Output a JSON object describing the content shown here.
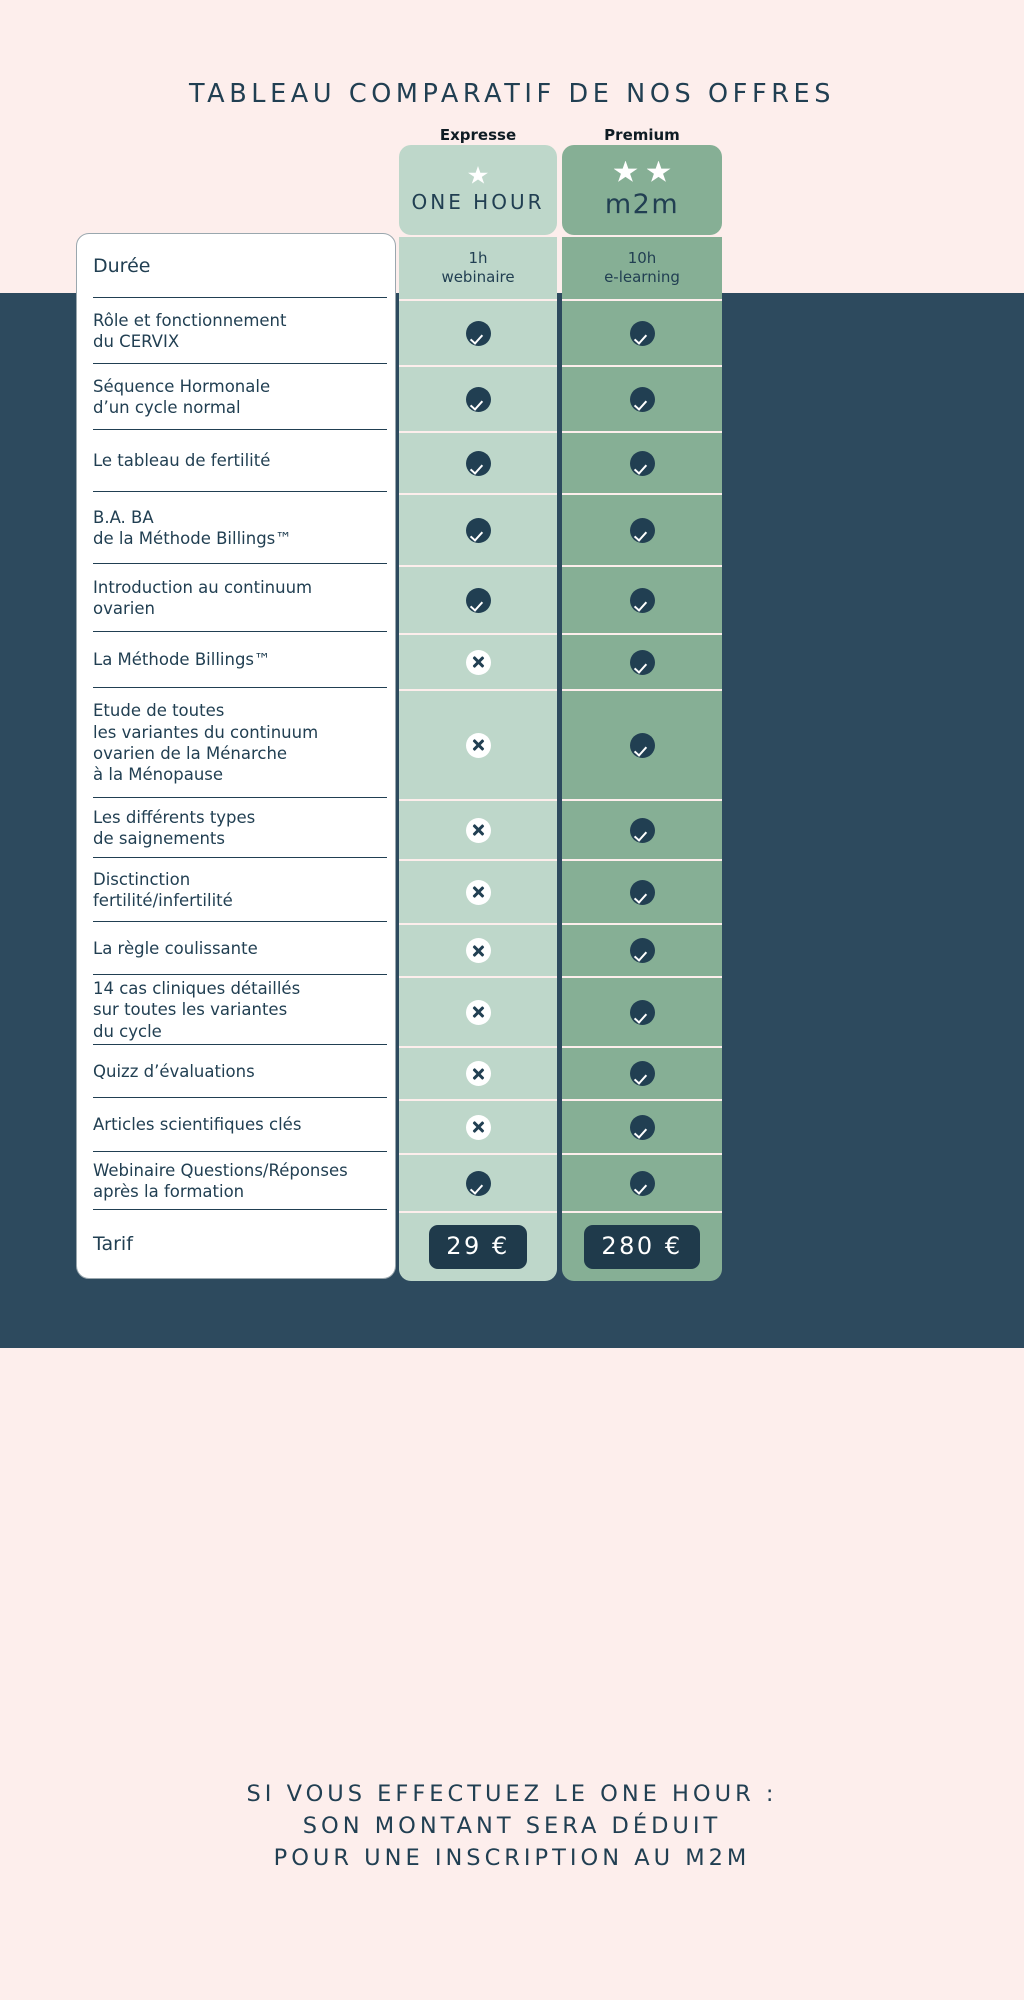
{
  "title": "TABLEAU COMPARATIF DE NOS OFFRES",
  "colors": {
    "background": "#FDEEEC",
    "band": "#2D4A5E",
    "navy": "#213F52",
    "expresse_green": "#BED7CA",
    "premium_green": "#86AF95",
    "panel_white": "#FFFFFF"
  },
  "plans": [
    {
      "label": "Expresse",
      "name": "ONE HOUR",
      "stars": 1,
      "duration": "1h\nwebinaire",
      "price": "29 €"
    },
    {
      "label": "Premium",
      "name": "m2m",
      "stars": 2,
      "duration": "10h\ne-learning",
      "price": "280 €"
    }
  ],
  "rows": [
    {
      "label": "Durée",
      "type": "duration"
    },
    {
      "label": "Rôle et fonctionnement\ndu CERVIX",
      "expresse": "check",
      "premium": "check"
    },
    {
      "label": "Séquence Hormonale\nd’un cycle normal",
      "expresse": "check",
      "premium": "check"
    },
    {
      "label": "Le tableau de fertilité",
      "expresse": "check",
      "premium": "check"
    },
    {
      "label": "B.A. BA\nde la Méthode Billings™",
      "expresse": "check",
      "premium": "check"
    },
    {
      "label": "Introduction au continuum\novarien",
      "expresse": "check",
      "premium": "check"
    },
    {
      "label": "La Méthode Billings™",
      "expresse": "cross",
      "premium": "check"
    },
    {
      "label": "Etude de toutes\nles variantes du continuum\novarien de la Ménarche\nà la Ménopause",
      "expresse": "cross",
      "premium": "check"
    },
    {
      "label": "Les différents types\nde saignements",
      "expresse": "cross",
      "premium": "check"
    },
    {
      "label": "Disctinction\nfertilité/infertilité",
      "expresse": "cross",
      "premium": "check"
    },
    {
      "label": "La règle coulissante",
      "expresse": "cross",
      "premium": "check"
    },
    {
      "label": "14 cas cliniques détaillés\nsur toutes les variantes\ndu cycle",
      "expresse": "cross",
      "premium": "check"
    },
    {
      "label": "Quizz d’évaluations",
      "expresse": "cross",
      "premium": "check"
    },
    {
      "label": "Articles scientifiques clés",
      "expresse": "cross",
      "premium": "check"
    },
    {
      "label": "Webinaire Questions/Réponses\naprès la formation",
      "expresse": "check",
      "premium": "check"
    },
    {
      "label": "Tarif",
      "type": "price"
    }
  ],
  "footer": [
    "SI VOUS EFFECTUEZ LE ONE HOUR :",
    "SON MONTANT SERA DÉDUIT",
    "POUR UNE INSCRIPTION AU M2M"
  ]
}
